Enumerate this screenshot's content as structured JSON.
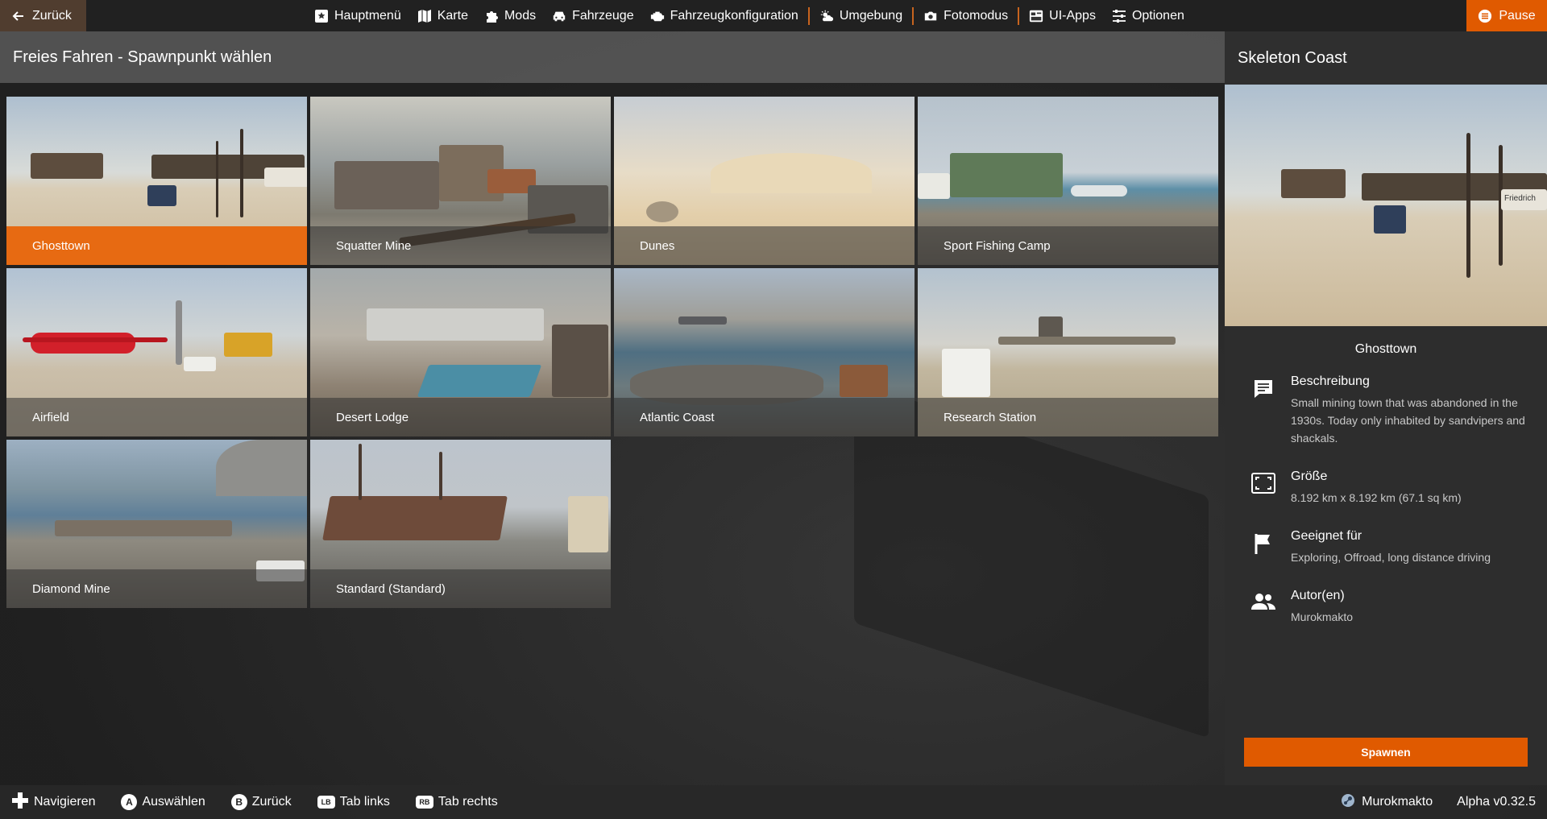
{
  "topbar": {
    "back_label": "Zurück",
    "nav": [
      {
        "label": "Hauptmenü",
        "icon": "main-menu-icon"
      },
      {
        "label": "Karte",
        "icon": "map-icon"
      },
      {
        "label": "Mods",
        "icon": "puzzle-icon"
      },
      {
        "label": "Fahrzeuge",
        "icon": "car-icon"
      },
      {
        "label": "Fahrzeugkonfiguration",
        "icon": "engine-icon"
      },
      {
        "label": "Umgebung",
        "icon": "weather-icon"
      },
      {
        "label": "Fotomodus",
        "icon": "camera-icon"
      },
      {
        "label": "UI-Apps",
        "icon": "ui-apps-icon"
      },
      {
        "label": "Optionen",
        "icon": "sliders-icon"
      }
    ],
    "pause_label": "Pause"
  },
  "header": {
    "title": "Freies Fahren - Spawnpunkt wählen"
  },
  "spawns": [
    {
      "label": "Ghosttown",
      "selected": true
    },
    {
      "label": "Squatter Mine"
    },
    {
      "label": "Dunes"
    },
    {
      "label": "Sport Fishing Camp"
    },
    {
      "label": "Airfield"
    },
    {
      "label": "Desert Lodge"
    },
    {
      "label": "Atlantic Coast"
    },
    {
      "label": "Research Station"
    },
    {
      "label": "Diamond Mine"
    },
    {
      "label": "Standard (Standard)"
    }
  ],
  "detail": {
    "map_title": "Skeleton Coast",
    "spawn_name": "Ghosttown",
    "sign_text": "Friedrich",
    "description_title": "Beschreibung",
    "description_text": "Small mining town that was abandoned in the 1930s. Today only inhabited by sandvipers and shackals.",
    "size_title": "Größe",
    "size_text": "8.192 km x 8.192 km (67.1 sq km)",
    "suitable_title": "Geeignet für",
    "suitable_text": "Exploring, Offroad, long distance driving",
    "authors_title": "Autor(en)",
    "authors_text": "Murokmakto",
    "spawn_button": "Spawnen"
  },
  "bottombar": {
    "hints": [
      {
        "glyph": "",
        "label": "Navigieren"
      },
      {
        "glyph": "A",
        "label": "Auswählen"
      },
      {
        "glyph": "B",
        "label": "Zurück"
      },
      {
        "glyph": "LB",
        "label": "Tab links"
      },
      {
        "glyph": "RB",
        "label": "Tab rechts"
      }
    ],
    "user": "Murokmakto",
    "version": "Alpha v0.32.5"
  },
  "colors": {
    "accent": "#e05a00",
    "selected": "#e76a12"
  }
}
